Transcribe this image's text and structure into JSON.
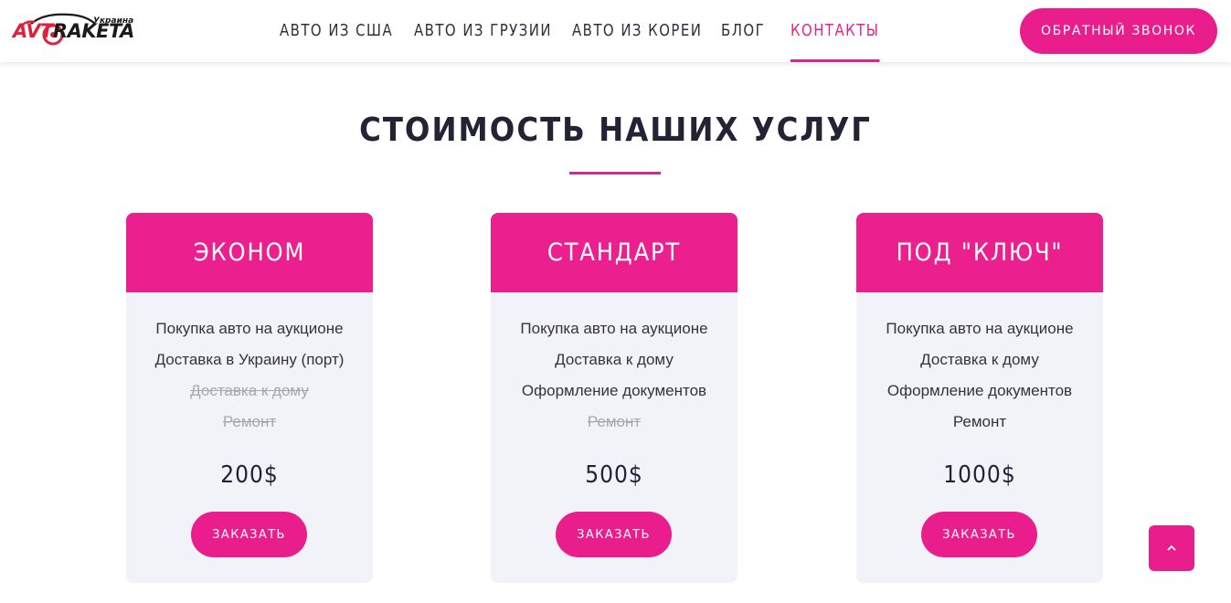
{
  "brand": {
    "logo_text_red": "AVT",
    "logo_text_dark": "RAKETA",
    "logo_sub": "Украина",
    "accent_color": "#e91e8c"
  },
  "nav": {
    "items": [
      {
        "label": "АВТО ИЗ США",
        "active": false
      },
      {
        "label": "АВТО ИЗ ГРУЗИИ",
        "active": false
      },
      {
        "label": "АВТО ИЗ КОРЕИ",
        "active": false
      },
      {
        "label": "БЛОГ",
        "active": false
      },
      {
        "label": "КОНТАКТЫ",
        "active": true
      }
    ],
    "callback_label": "ОБРАТНЫЙ ЗВОНОК"
  },
  "section": {
    "title": "СТОИМОСТЬ НАШИХ УСЛУГ"
  },
  "plans": [
    {
      "name": "ЭКОНОМ",
      "features": [
        {
          "text": "Покупка авто на аукционе",
          "included": true
        },
        {
          "text": "Доставка в Украину (порт)",
          "included": true
        },
        {
          "text": "Доставка к дому",
          "included": false
        },
        {
          "text": "Ремонт",
          "included": false
        }
      ],
      "price": "200$",
      "button_label": "ЗАКАЗАТЬ"
    },
    {
      "name": "СТАНДАРТ",
      "features": [
        {
          "text": "Покупка авто на аукционе",
          "included": true
        },
        {
          "text": "Доставка к дому",
          "included": true
        },
        {
          "text": "Оформление документов",
          "included": true
        },
        {
          "text": "Ремонт",
          "included": false
        }
      ],
      "price": "500$",
      "button_label": "ЗАКАЗАТЬ"
    },
    {
      "name": "ПОД \"КЛЮЧ\"",
      "features": [
        {
          "text": "Покупка авто на аукционе",
          "included": true
        },
        {
          "text": "Доставка к дому",
          "included": true
        },
        {
          "text": "Оформление документов",
          "included": true
        },
        {
          "text": "Ремонт",
          "included": true
        }
      ],
      "price": "1000$",
      "button_label": "ЗАКАЗАТЬ"
    }
  ],
  "scroll_top_icon": "chevron-up-icon"
}
